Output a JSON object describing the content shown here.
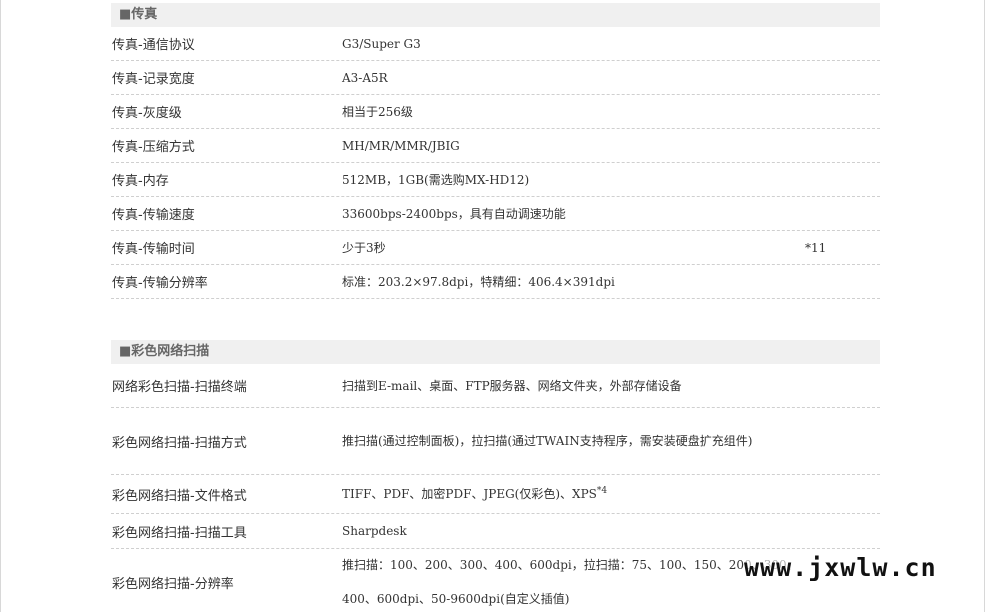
{
  "fax": {
    "header": "■传真",
    "rows": [
      {
        "label": "传真-通信协议",
        "value": "G3/Super G3",
        "note": ""
      },
      {
        "label": "传真-记录宽度",
        "value": "A3-A5R",
        "note": ""
      },
      {
        "label": "传真-灰度级",
        "value": "相当于256级",
        "note": ""
      },
      {
        "label": "传真-压缩方式",
        "value": "MH/MR/MMR/JBIG",
        "note": ""
      },
      {
        "label": "传真-内存",
        "value": "512MB，1GB(需选购MX-HD12)",
        "note": ""
      },
      {
        "label": "传真-传输速度",
        "value": "33600bps-2400bps，具有自动调速功能",
        "note": ""
      },
      {
        "label": "传真-传输时间",
        "value": "少于3秒",
        "note": "*11"
      },
      {
        "label": "传真-传输分辨率",
        "value": "标准：203.2×97.8dpi，特精细：406.4×391dpi",
        "note": ""
      }
    ]
  },
  "scan": {
    "header": "■彩色网络扫描",
    "rows": [
      {
        "label": "网络彩色扫描-扫描终端",
        "value": "扫描到E-mail、桌面、FTP服务器、网络文件夹，外部存储设备"
      },
      {
        "label": "彩色网络扫描-扫描方式",
        "value": "推扫描(通过控制面板)，拉扫描(通过TWAIN支持程序，需安装硬盘扩充组件)"
      },
      {
        "label": "彩色网络扫描-文件格式",
        "value": "TIFF、PDF、加密PDF、JPEG(仅彩色)、XPS",
        "sup": "*4"
      },
      {
        "label": "彩色网络扫描-扫描工具",
        "value": "Sharpdesk"
      },
      {
        "label": "彩色网络扫描-分辨率",
        "value": "推扫描：100、200、300、400、600dpi，拉扫描：75、100、150、200、300、400、600dpi、50-9600dpi(自定义插值)"
      }
    ]
  },
  "watermark": "www.jxwlw.cn"
}
